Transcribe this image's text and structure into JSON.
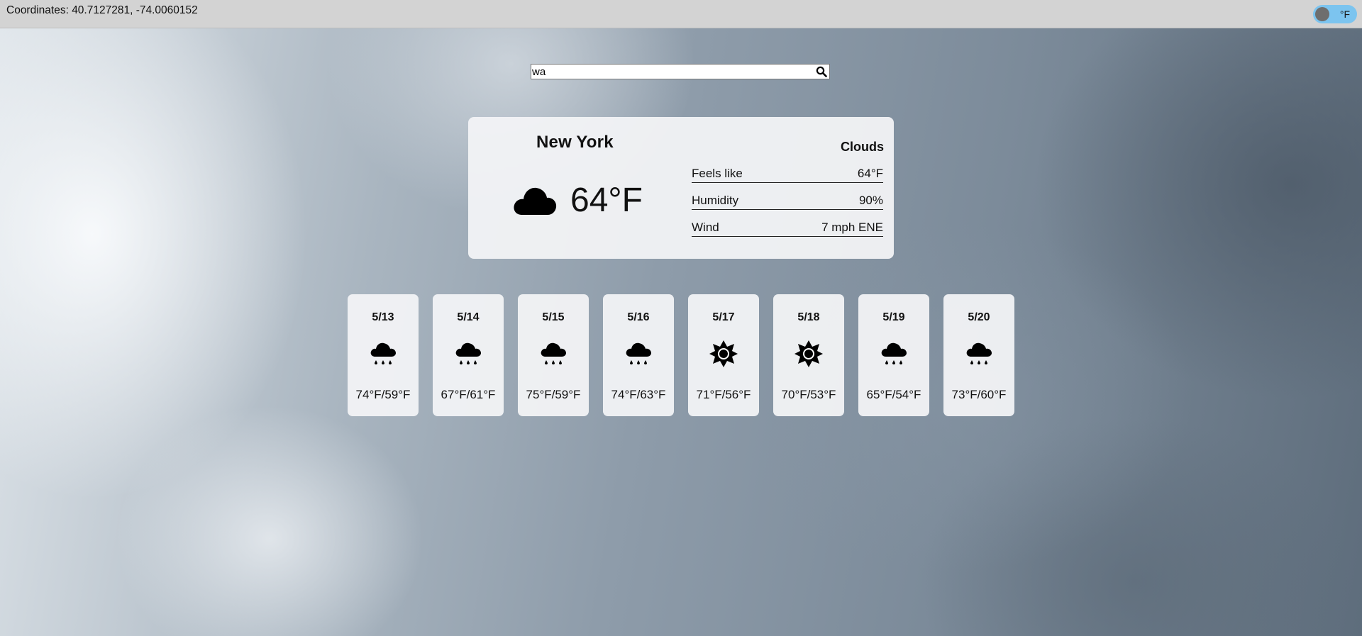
{
  "header": {
    "coordinates": "Coordinates: 40.7127281, -74.0060152",
    "unit_toggle_label": "°F"
  },
  "search": {
    "value": "wa",
    "icon": "search-icon"
  },
  "current": {
    "city": "New York",
    "icon": "cloud-icon",
    "temperature": "64°F",
    "condition": "Clouds",
    "details": {
      "feels_like_label": "Feels like",
      "feels_like_value": "64°F",
      "humidity_label": "Humidity",
      "humidity_value": "90%",
      "wind_label": "Wind",
      "wind_value": "7 mph ENE"
    }
  },
  "forecast": [
    {
      "date": "5/13",
      "icon": "rain-icon",
      "temps": "74°F/59°F"
    },
    {
      "date": "5/14",
      "icon": "rain-icon",
      "temps": "67°F/61°F"
    },
    {
      "date": "5/15",
      "icon": "rain-icon",
      "temps": "75°F/59°F"
    },
    {
      "date": "5/16",
      "icon": "rain-icon",
      "temps": "74°F/63°F"
    },
    {
      "date": "5/17",
      "icon": "sun-icon",
      "temps": "71°F/56°F"
    },
    {
      "date": "5/18",
      "icon": "sun-icon",
      "temps": "70°F/53°F"
    },
    {
      "date": "5/19",
      "icon": "rain-icon",
      "temps": "65°F/54°F"
    },
    {
      "date": "5/20",
      "icon": "rain-icon",
      "temps": "73°F/60°F"
    }
  ]
}
